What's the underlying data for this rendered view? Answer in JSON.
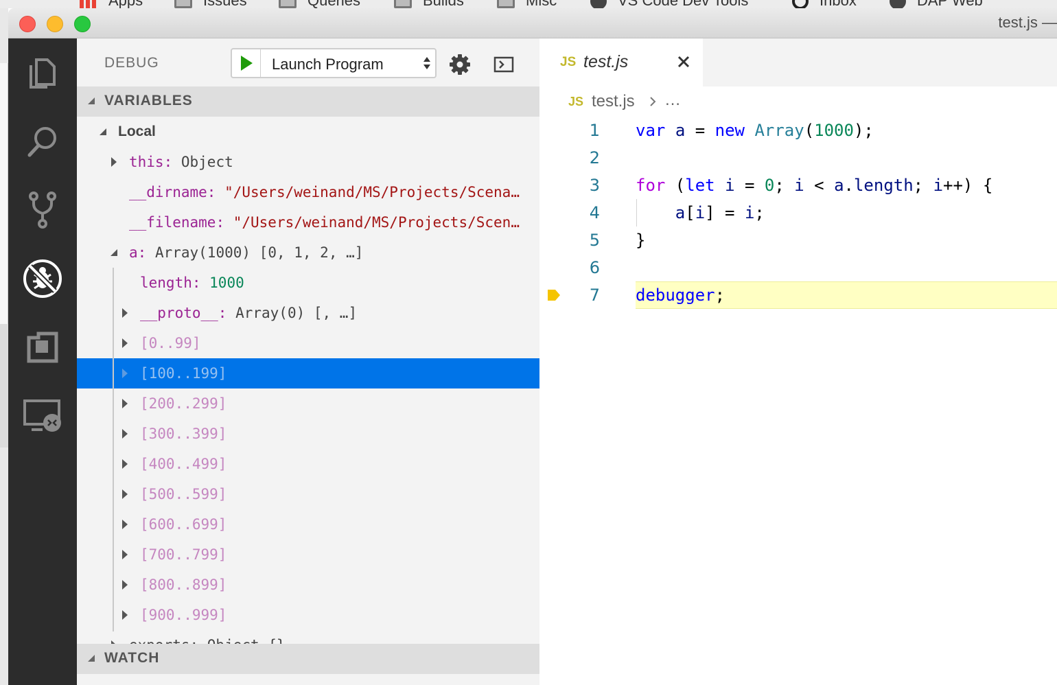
{
  "bookmarks": [
    {
      "label": "Apps",
      "icon": "apps-grid-icon"
    },
    {
      "label": "Issues",
      "icon": "folder-icon"
    },
    {
      "label": "Queries",
      "icon": "folder-icon"
    },
    {
      "label": "Builds",
      "icon": "folder-icon"
    },
    {
      "label": "Misc",
      "icon": "folder-icon"
    },
    {
      "label": "VS Code Dev Tools",
      "icon": "globe-icon"
    },
    {
      "label": "Inbox",
      "icon": "github-icon"
    },
    {
      "label": "DAP Web",
      "icon": "globe-icon"
    }
  ],
  "window": {
    "title": "test.js —"
  },
  "activity_bar": {
    "items": [
      "explorer-icon",
      "search-icon",
      "source-control-icon",
      "debug-icon",
      "extensions-icon",
      "remote-explorer-icon"
    ],
    "active": "debug-icon"
  },
  "debug": {
    "title": "DEBUG",
    "launch_config": "Launch Program",
    "play_color": "#1f9b0a"
  },
  "variables": {
    "header": "VARIABLES",
    "scope": "Local",
    "rows": [
      {
        "key": "this",
        "sep": ": ",
        "value": "Object",
        "kind": "obj",
        "twisty": "collapsed"
      },
      {
        "key": "__dirname",
        "sep": ": ",
        "value": "\"/Users/weinand/MS/Projects/Scena…",
        "kind": "str",
        "twisty": "none"
      },
      {
        "key": "__filename",
        "sep": ": ",
        "value": "\"/Users/weinand/MS/Projects/Scen…",
        "kind": "str",
        "twisty": "none"
      },
      {
        "key": "a",
        "sep": ": ",
        "value": "Array(1000) [0, 1, 2, …]",
        "kind": "obj",
        "twisty": "expanded"
      },
      {
        "key": "length",
        "sep": ": ",
        "value": "1000",
        "kind": "num",
        "twisty": "none"
      },
      {
        "key": "__proto__",
        "sep": ": ",
        "value": "Array(0) [, …]",
        "kind": "obj",
        "twisty": "collapsed"
      }
    ],
    "ranges": [
      "[0..99]",
      "[100..199]",
      "[200..299]",
      "[300..399]",
      "[400..499]",
      "[500..599]",
      "[600..699]",
      "[700..799]",
      "[800..899]",
      "[900..999]"
    ],
    "selected_range": "[100..199]",
    "partial_row": "exports: Object {}"
  },
  "watch": {
    "header": "WATCH"
  },
  "editor": {
    "tab_title": "test.js",
    "file_badge": "JS",
    "breadcrumb_file": "test.js",
    "breadcrumb_more": "…",
    "current_line": 7,
    "lines": [
      {
        "n": "1",
        "tokens": [
          [
            "var",
            "kw"
          ],
          [
            " ",
            "pun"
          ],
          [
            "a",
            "var"
          ],
          [
            " = ",
            "pun"
          ],
          [
            "new",
            "kw"
          ],
          [
            " ",
            "pun"
          ],
          [
            "Array",
            "cls"
          ],
          [
            "(",
            "pun"
          ],
          [
            "1000",
            "num"
          ],
          [
            ");",
            "pun"
          ]
        ]
      },
      {
        "n": "2",
        "tokens": []
      },
      {
        "n": "3",
        "tokens": [
          [
            "for",
            "kw2"
          ],
          [
            " (",
            "pun"
          ],
          [
            "let",
            "kw"
          ],
          [
            " ",
            "pun"
          ],
          [
            "i",
            "var"
          ],
          [
            " = ",
            "pun"
          ],
          [
            "0",
            "num"
          ],
          [
            "; ",
            "pun"
          ],
          [
            "i",
            "var"
          ],
          [
            " < ",
            "pun"
          ],
          [
            "a",
            "var"
          ],
          [
            ".",
            "pun"
          ],
          [
            "length",
            "var"
          ],
          [
            "; ",
            "pun"
          ],
          [
            "i",
            "var"
          ],
          [
            "++) {",
            "pun"
          ]
        ]
      },
      {
        "n": "4",
        "tokens": [
          [
            "    ",
            "pun"
          ],
          [
            "a",
            "var"
          ],
          [
            "[",
            "pun"
          ],
          [
            "i",
            "var"
          ],
          [
            "] = ",
            "pun"
          ],
          [
            "i",
            "var"
          ],
          [
            ";",
            "pun"
          ]
        ]
      },
      {
        "n": "5",
        "tokens": [
          [
            "}",
            "pun"
          ]
        ]
      },
      {
        "n": "6",
        "tokens": []
      },
      {
        "n": "7",
        "tokens": [
          [
            "debugger",
            "kw"
          ],
          [
            ";",
            "pun"
          ]
        ]
      }
    ]
  }
}
